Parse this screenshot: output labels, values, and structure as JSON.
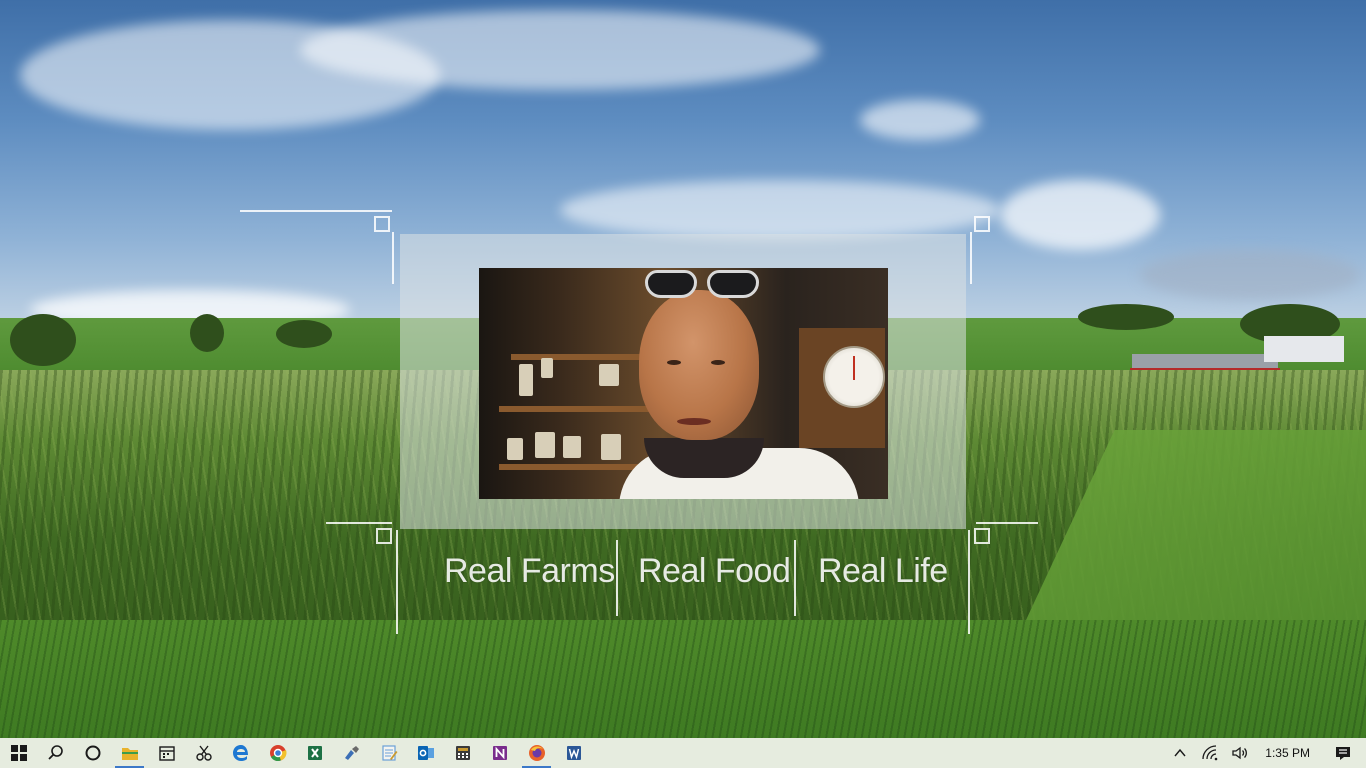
{
  "video": {
    "tagline": [
      "Real Farms",
      "Real Food",
      "Real Life"
    ]
  },
  "taskbar": {
    "apps": [
      {
        "name": "start-icon",
        "color": "#1a1a1a",
        "active": false
      },
      {
        "name": "search-icon",
        "color": "#1a1a1a",
        "active": false
      },
      {
        "name": "cortana-icon",
        "color": "#1a1a1a",
        "active": false
      },
      {
        "name": "file-explorer-icon",
        "color": "#e8b32c",
        "active": true
      },
      {
        "name": "calendar-icon",
        "color": "#1a1a1a",
        "active": false
      },
      {
        "name": "snipping-tool-icon",
        "color": "#1a1a1a",
        "active": false
      },
      {
        "name": "edge-icon",
        "color": "#1e78d2",
        "active": false
      },
      {
        "name": "chrome-icon",
        "color": "#d8402c",
        "active": false
      },
      {
        "name": "excel-icon",
        "color": "#1d7145",
        "active": false
      },
      {
        "name": "paint-icon",
        "color": "#3b6fb6",
        "active": false
      },
      {
        "name": "notepad-icon",
        "color": "#6aa0d8",
        "active": false
      },
      {
        "name": "outlook-icon",
        "color": "#0a64b4",
        "active": false
      },
      {
        "name": "calculator-icon",
        "color": "#c89a30",
        "active": false
      },
      {
        "name": "onenote-icon",
        "color": "#7a2c8c",
        "active": false
      },
      {
        "name": "firefox-icon",
        "color": "#e8622a",
        "active": true
      },
      {
        "name": "word-icon",
        "color": "#2b5797",
        "active": false
      }
    ],
    "tray": {
      "chevron_icon": "chevron-up-icon",
      "network_icon": "wifi-icon",
      "volume_icon": "volume-icon",
      "time": "1:35 PM",
      "notification_icon": "action-center-icon"
    }
  }
}
